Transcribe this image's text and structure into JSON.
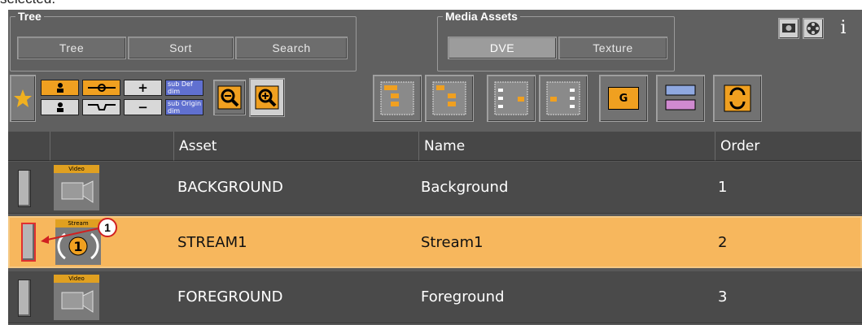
{
  "caption": "selected.",
  "tree_group": {
    "title": "Tree",
    "tabs": [
      "Tree",
      "Sort",
      "Search"
    ]
  },
  "media_group": {
    "title": "Media Assets",
    "tabs": [
      "DVE",
      "Texture"
    ],
    "active_tab": "DVE"
  },
  "top_right_icons": [
    "monitor-icon",
    "film-reel-icon",
    "info-icon"
  ],
  "info_label": "i",
  "toolbar": {
    "plus_label": "+",
    "minus_label": "−",
    "sub_def_label": "sub Def dim",
    "sub_origin_label": "sub Origin dim",
    "group_label": "G"
  },
  "table": {
    "columns": [
      "",
      "",
      "Asset",
      "Name",
      "Order"
    ],
    "rows": [
      {
        "thumb_label": "Video",
        "asset": "BACKGROUND",
        "name": "Background",
        "order": "1",
        "selected": false
      },
      {
        "thumb_label": "Stream",
        "asset": "STREAM1",
        "name": "Stream1",
        "order": "2",
        "selected": true
      },
      {
        "thumb_label": "Video",
        "asset": "FOREGROUND",
        "name": "Foreground",
        "order": "3",
        "selected": false
      }
    ]
  },
  "callout": {
    "number": "1"
  },
  "colors": {
    "panel": "#606060",
    "selected_row": "#f7b75d",
    "accent": "#f0a020",
    "callout": "#d02020"
  }
}
